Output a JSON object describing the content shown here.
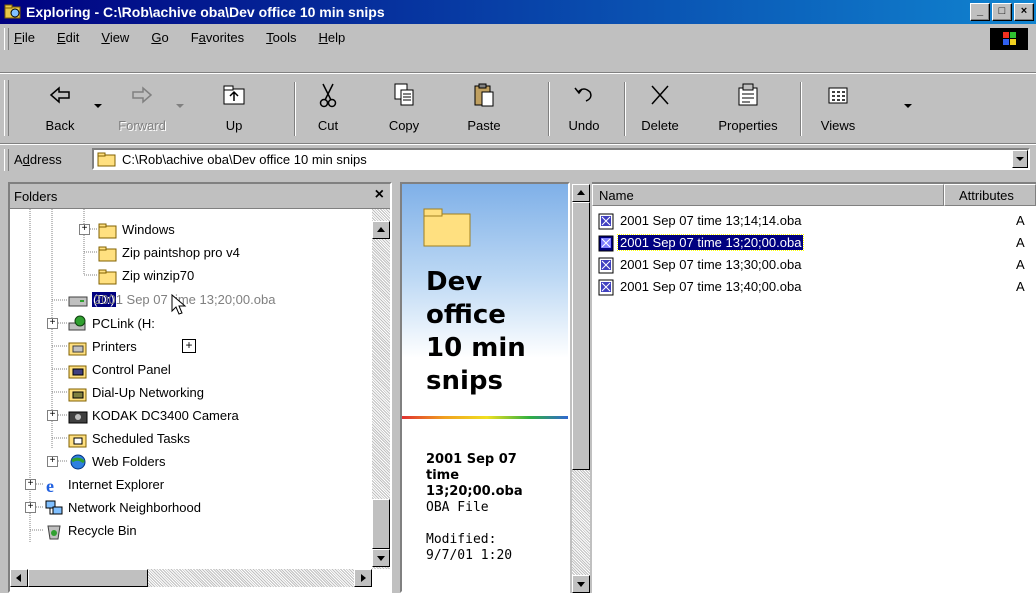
{
  "window": {
    "title": "Exploring - C:\\Rob\\achive oba\\Dev office 10 min snips"
  },
  "menu": {
    "items": [
      {
        "pre": "",
        "acc": "F",
        "post": "ile"
      },
      {
        "pre": "",
        "acc": "E",
        "post": "dit"
      },
      {
        "pre": "",
        "acc": "V",
        "post": "iew"
      },
      {
        "pre": "",
        "acc": "G",
        "post": "o"
      },
      {
        "pre": "F",
        "acc": "a",
        "post": "vorites"
      },
      {
        "pre": "",
        "acc": "T",
        "post": "ools"
      },
      {
        "pre": "",
        "acc": "H",
        "post": "elp"
      }
    ]
  },
  "toolbar": {
    "back": "Back",
    "forward": "Forward",
    "up": "Up",
    "cut": "Cut",
    "copy": "Copy",
    "paste": "Paste",
    "undo": "Undo",
    "delete": "Delete",
    "properties": "Properties",
    "views": "Views"
  },
  "address": {
    "label_pre": "A",
    "label_acc": "d",
    "label_post": "dress",
    "value": "C:\\Rob\\achive oba\\Dev office 10 min snips"
  },
  "folders": {
    "header": "Folders",
    "close": "×",
    "drag_label": "(D:)",
    "drag_ghost": "2001 Sep 07  time 13;20;00.oba",
    "items": [
      "Windows",
      "Zip paintshop pro v4",
      "Zip winzip70",
      "PCLink (H:)",
      "Printers",
      "Control Panel",
      "Dial-Up Networking",
      "KODAK DC3400 Camera",
      "Scheduled Tasks",
      "Web Folders",
      "Internet Explorer",
      "Network Neighborhood",
      "Recycle Bin"
    ],
    "pcLinkVisible": "PCLink (H:"
  },
  "webview": {
    "folder_title_lines": [
      "Dev",
      "office",
      "10 min",
      "snips"
    ],
    "selected_name_lines": [
      "2001 Sep 07",
      "time",
      "13;20;00.oba"
    ],
    "type": "OBA File",
    "modified_label": "Modified:",
    "modified_value": "9/7/01 1:20"
  },
  "filelist": {
    "columns": [
      "Name",
      "Attributes"
    ],
    "rows": [
      {
        "name": "2001 Sep 07   time 13;14;14.oba",
        "attr": "A"
      },
      {
        "name": "2001 Sep 07   time 13;20;00.oba",
        "attr": "A"
      },
      {
        "name": "2001 Sep 07   time 13;30;00.oba",
        "attr": "A"
      },
      {
        "name": "2001 Sep 07   time 13;40;00.oba",
        "attr": "A"
      }
    ]
  }
}
